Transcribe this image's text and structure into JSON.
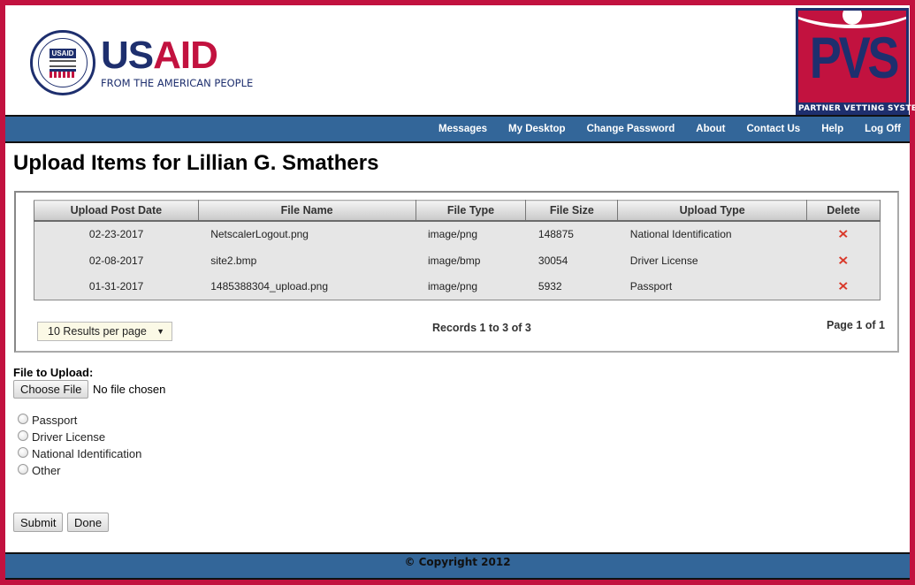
{
  "header": {
    "usaid": {
      "seal_text": "USAID",
      "wordmark_us": "US",
      "wordmark_aid": "AID",
      "tagline": "FROM THE AMERICAN PEOPLE"
    },
    "pvs": {
      "letters": "PVS",
      "caption": "PARTNER VETTING SYSTEM"
    }
  },
  "nav": {
    "items": [
      {
        "label": "Messages"
      },
      {
        "label": "My Desktop"
      },
      {
        "label": "Change Password"
      },
      {
        "label": "About"
      },
      {
        "label": "Contact Us"
      },
      {
        "label": "Help"
      },
      {
        "label": "Log Off"
      }
    ]
  },
  "page": {
    "title": "Upload Items for Lillian G. Smathers"
  },
  "grid": {
    "columns": [
      "Upload Post Date",
      "File Name",
      "File Type",
      "File Size",
      "Upload Type",
      "Delete"
    ],
    "rows": [
      {
        "date": "02-23-2017",
        "file_name": "NetscalerLogout.png",
        "file_type": "image/png",
        "file_size": "148875",
        "upload_type": "National Identification",
        "delete_icon": "✕"
      },
      {
        "date": "02-08-2017",
        "file_name": "site2.bmp",
        "file_type": "image/bmp",
        "file_size": "30054",
        "upload_type": "Driver License",
        "delete_icon": "✕"
      },
      {
        "date": "01-31-2017",
        "file_name": "1485388304_upload.png",
        "file_type": "image/png",
        "file_size": "5932",
        "upload_type": "Passport",
        "delete_icon": "✕"
      }
    ],
    "results_per_page": "10 Results per page",
    "select_arrow": "▼",
    "records_text": "Records 1 to 3 of 3",
    "page_text": "Page 1 of 1"
  },
  "upload": {
    "label": "File to Upload:",
    "choose_button": "Choose File",
    "no_file_text": "No file chosen",
    "options": [
      "Passport",
      "Driver License",
      "National Identification",
      "Other"
    ],
    "submit_label": "Submit",
    "done_label": "Done"
  },
  "footer": {
    "copyright": "© Copyright 2012"
  },
  "colors": {
    "brand_red": "#c2123f",
    "brand_navy": "#1e2f6e",
    "nav_blue": "#336699",
    "delete_red": "#d93a2b"
  }
}
